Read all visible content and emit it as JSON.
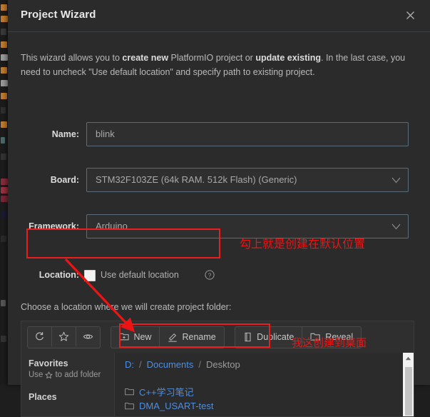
{
  "window": {
    "title": "Project Wizard",
    "close_icon": "close-icon"
  },
  "intro": {
    "part1": "This wizard allows you to ",
    "bold1": "create new",
    "part2": " PlatformIO project or ",
    "bold2": "update existing",
    "part3": ". In the last case, you need to uncheck \"Use default location\" and specify path to existing project."
  },
  "form": {
    "name": {
      "label": "Name:",
      "value": "blink",
      "placeholder": "blink"
    },
    "board": {
      "label": "Board:",
      "value": "STM32F103ZE (64k RAM. 512k Flash) (Generic)",
      "chevron_icon": "chevron-down-icon"
    },
    "framework": {
      "label": "Framework:",
      "value": "Arduino",
      "chevron_icon": "chevron-down-icon"
    },
    "location": {
      "label": "Location:",
      "checkbox_label": "Use default location",
      "checked": false,
      "help_icon": "question-circle-icon"
    }
  },
  "choose_label": "Choose a location where we will create project folder:",
  "toolbar": {
    "icon_buttons": [
      {
        "name": "refresh-button",
        "icon": "refresh-icon"
      },
      {
        "name": "favorite-button",
        "icon": "star-icon"
      },
      {
        "name": "show-hidden-button",
        "icon": "eye-icon"
      }
    ],
    "new_label": "New",
    "rename_label": "Rename",
    "duplicate_label": "Duplicate",
    "reveal_label": "Reveal"
  },
  "sidebar": {
    "favorites_title": "Favorites",
    "favorites_hint_pre": "Use",
    "favorites_hint_post": "to add folder",
    "favorites_hint_icon": "star-icon",
    "places_title": "Places"
  },
  "breadcrumb": {
    "segments": [
      "D:",
      "Documents",
      "Desktop"
    ],
    "separator": "/"
  },
  "filelist": [
    {
      "name": "C++学习笔记",
      "icon": "folder-icon"
    },
    {
      "name": "DMA_USART-test",
      "icon": "folder-icon"
    }
  ],
  "scrollbar": {
    "up_arrow_icon": "caret-up-icon"
  },
  "annotations": {
    "location_note": "勾上就是创建在默认位置",
    "path_note": "我这创建到桌面",
    "color": "#ee1414"
  },
  "colors": {
    "dialog_bg": "#2b2b2b",
    "field_border": "#5a6b7a",
    "link": "#4d8ee0",
    "annotation_red": "#ee1414"
  }
}
